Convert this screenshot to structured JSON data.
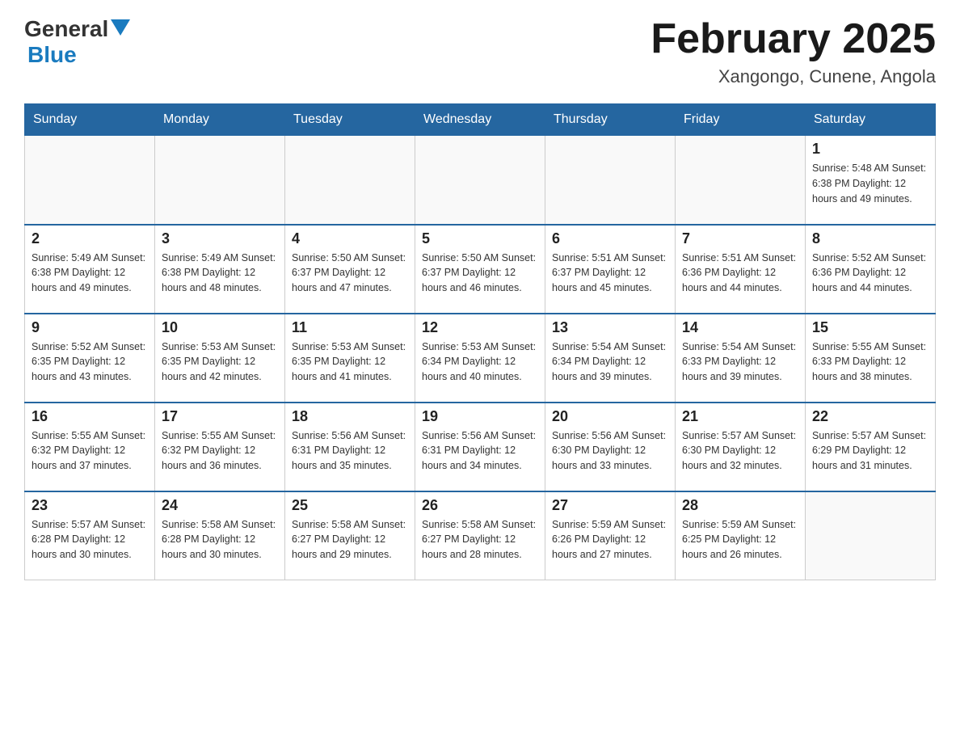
{
  "header": {
    "logo_general": "General",
    "logo_blue": "Blue",
    "month_title": "February 2025",
    "location": "Xangongo, Cunene, Angola"
  },
  "weekdays": [
    "Sunday",
    "Monday",
    "Tuesday",
    "Wednesday",
    "Thursday",
    "Friday",
    "Saturday"
  ],
  "weeks": [
    [
      {
        "day": "",
        "info": ""
      },
      {
        "day": "",
        "info": ""
      },
      {
        "day": "",
        "info": ""
      },
      {
        "day": "",
        "info": ""
      },
      {
        "day": "",
        "info": ""
      },
      {
        "day": "",
        "info": ""
      },
      {
        "day": "1",
        "info": "Sunrise: 5:48 AM\nSunset: 6:38 PM\nDaylight: 12 hours\nand 49 minutes."
      }
    ],
    [
      {
        "day": "2",
        "info": "Sunrise: 5:49 AM\nSunset: 6:38 PM\nDaylight: 12 hours\nand 49 minutes."
      },
      {
        "day": "3",
        "info": "Sunrise: 5:49 AM\nSunset: 6:38 PM\nDaylight: 12 hours\nand 48 minutes."
      },
      {
        "day": "4",
        "info": "Sunrise: 5:50 AM\nSunset: 6:37 PM\nDaylight: 12 hours\nand 47 minutes."
      },
      {
        "day": "5",
        "info": "Sunrise: 5:50 AM\nSunset: 6:37 PM\nDaylight: 12 hours\nand 46 minutes."
      },
      {
        "day": "6",
        "info": "Sunrise: 5:51 AM\nSunset: 6:37 PM\nDaylight: 12 hours\nand 45 minutes."
      },
      {
        "day": "7",
        "info": "Sunrise: 5:51 AM\nSunset: 6:36 PM\nDaylight: 12 hours\nand 44 minutes."
      },
      {
        "day": "8",
        "info": "Sunrise: 5:52 AM\nSunset: 6:36 PM\nDaylight: 12 hours\nand 44 minutes."
      }
    ],
    [
      {
        "day": "9",
        "info": "Sunrise: 5:52 AM\nSunset: 6:35 PM\nDaylight: 12 hours\nand 43 minutes."
      },
      {
        "day": "10",
        "info": "Sunrise: 5:53 AM\nSunset: 6:35 PM\nDaylight: 12 hours\nand 42 minutes."
      },
      {
        "day": "11",
        "info": "Sunrise: 5:53 AM\nSunset: 6:35 PM\nDaylight: 12 hours\nand 41 minutes."
      },
      {
        "day": "12",
        "info": "Sunrise: 5:53 AM\nSunset: 6:34 PM\nDaylight: 12 hours\nand 40 minutes."
      },
      {
        "day": "13",
        "info": "Sunrise: 5:54 AM\nSunset: 6:34 PM\nDaylight: 12 hours\nand 39 minutes."
      },
      {
        "day": "14",
        "info": "Sunrise: 5:54 AM\nSunset: 6:33 PM\nDaylight: 12 hours\nand 39 minutes."
      },
      {
        "day": "15",
        "info": "Sunrise: 5:55 AM\nSunset: 6:33 PM\nDaylight: 12 hours\nand 38 minutes."
      }
    ],
    [
      {
        "day": "16",
        "info": "Sunrise: 5:55 AM\nSunset: 6:32 PM\nDaylight: 12 hours\nand 37 minutes."
      },
      {
        "day": "17",
        "info": "Sunrise: 5:55 AM\nSunset: 6:32 PM\nDaylight: 12 hours\nand 36 minutes."
      },
      {
        "day": "18",
        "info": "Sunrise: 5:56 AM\nSunset: 6:31 PM\nDaylight: 12 hours\nand 35 minutes."
      },
      {
        "day": "19",
        "info": "Sunrise: 5:56 AM\nSunset: 6:31 PM\nDaylight: 12 hours\nand 34 minutes."
      },
      {
        "day": "20",
        "info": "Sunrise: 5:56 AM\nSunset: 6:30 PM\nDaylight: 12 hours\nand 33 minutes."
      },
      {
        "day": "21",
        "info": "Sunrise: 5:57 AM\nSunset: 6:30 PM\nDaylight: 12 hours\nand 32 minutes."
      },
      {
        "day": "22",
        "info": "Sunrise: 5:57 AM\nSunset: 6:29 PM\nDaylight: 12 hours\nand 31 minutes."
      }
    ],
    [
      {
        "day": "23",
        "info": "Sunrise: 5:57 AM\nSunset: 6:28 PM\nDaylight: 12 hours\nand 30 minutes."
      },
      {
        "day": "24",
        "info": "Sunrise: 5:58 AM\nSunset: 6:28 PM\nDaylight: 12 hours\nand 30 minutes."
      },
      {
        "day": "25",
        "info": "Sunrise: 5:58 AM\nSunset: 6:27 PM\nDaylight: 12 hours\nand 29 minutes."
      },
      {
        "day": "26",
        "info": "Sunrise: 5:58 AM\nSunset: 6:27 PM\nDaylight: 12 hours\nand 28 minutes."
      },
      {
        "day": "27",
        "info": "Sunrise: 5:59 AM\nSunset: 6:26 PM\nDaylight: 12 hours\nand 27 minutes."
      },
      {
        "day": "28",
        "info": "Sunrise: 5:59 AM\nSunset: 6:25 PM\nDaylight: 12 hours\nand 26 minutes."
      },
      {
        "day": "",
        "info": ""
      }
    ]
  ]
}
